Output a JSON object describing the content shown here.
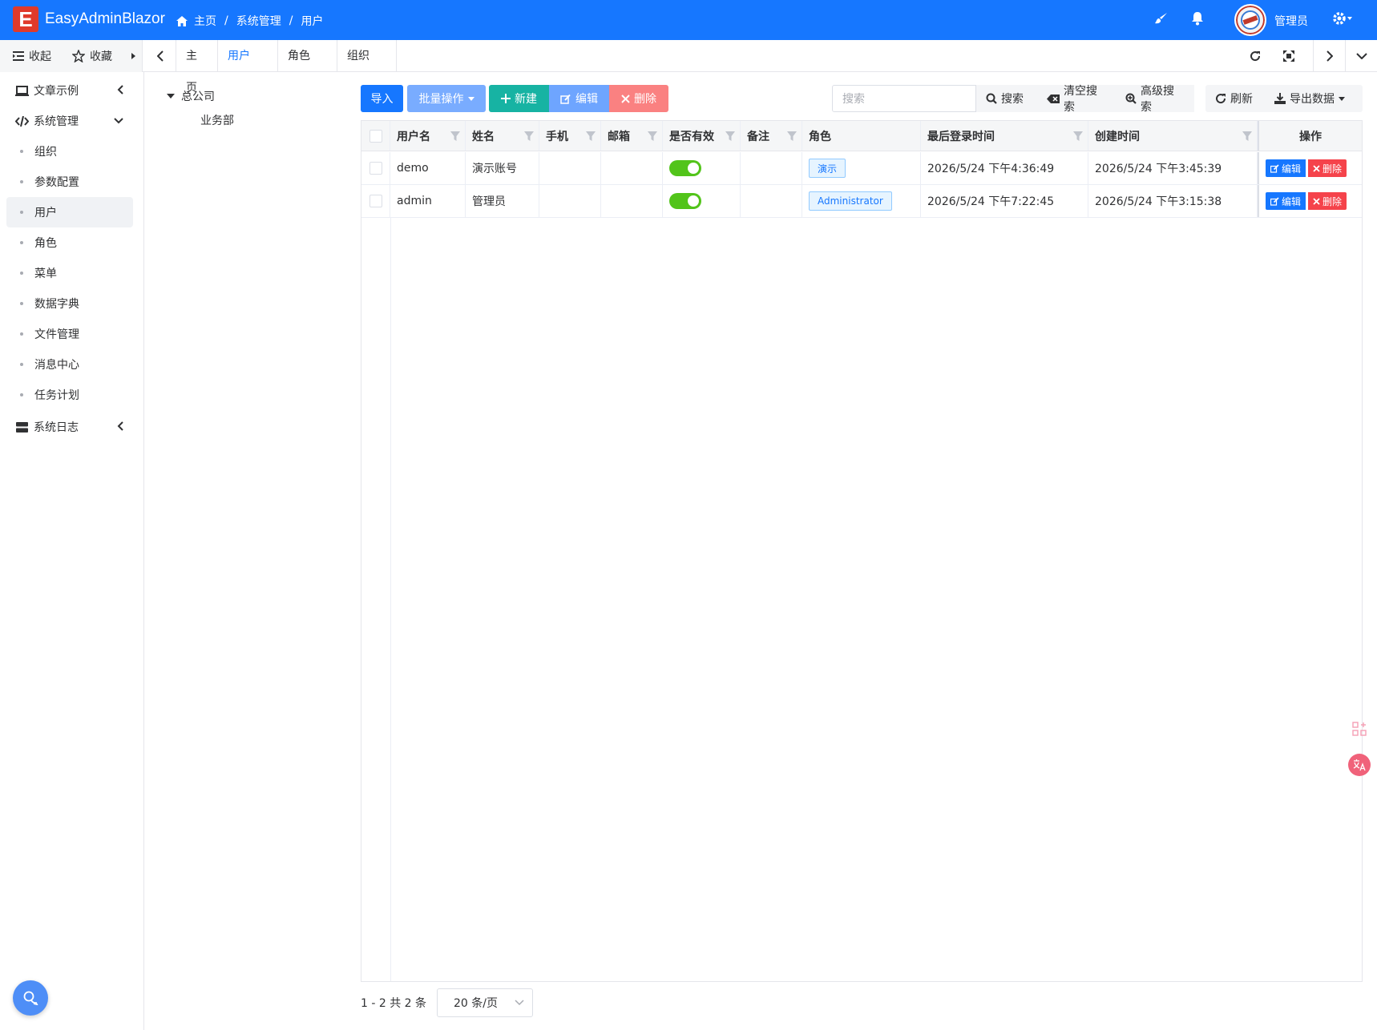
{
  "header": {
    "logo_letter": "E",
    "app_title": "EasyAdminBlazor",
    "breadcrumb": [
      "主页",
      "系统管理",
      "用户"
    ],
    "user_name": "管理员"
  },
  "tabbar": {
    "collapse_label": "收起",
    "favorites_label": "收藏",
    "tabs": [
      "主页",
      "用户",
      "角色",
      "组织"
    ],
    "active_tab": "用户"
  },
  "sidebar": {
    "groups": [
      {
        "label": "文章示例",
        "icon": "laptop-icon",
        "expanded": false
      },
      {
        "label": "系统管理",
        "icon": "code-icon",
        "expanded": true
      },
      {
        "label": "系统日志",
        "icon": "server-icon",
        "expanded": false
      }
    ],
    "sub_items": [
      "组织",
      "参数配置",
      "用户",
      "角色",
      "菜单",
      "数据字典",
      "文件管理",
      "消息中心",
      "任务计划"
    ],
    "active_item": "用户"
  },
  "org_tree": {
    "root": "总公司",
    "children": [
      "业务部"
    ]
  },
  "toolbar": {
    "import": "导入",
    "batch": "批量操作",
    "new": "新建",
    "edit": "编辑",
    "delete": "删除",
    "search_placeholder": "搜索",
    "search": "搜索",
    "clear_search": "清空搜索",
    "advanced_search": "高级搜索",
    "refresh": "刷新",
    "export": "导出数据"
  },
  "table": {
    "columns": [
      "用户名",
      "姓名",
      "手机",
      "邮箱",
      "是否有效",
      "备注",
      "角色",
      "最后登录时间",
      "创建时间",
      "操作"
    ],
    "rows": [
      {
        "username": "demo",
        "name": "演示账号",
        "phone": "",
        "email": "",
        "active": true,
        "remark": "",
        "role": "演示",
        "last_login": "2026/5/24 下午4:36:49",
        "created": "2026/5/24 下午3:45:39"
      },
      {
        "username": "admin",
        "name": "管理员",
        "phone": "",
        "email": "",
        "active": true,
        "remark": "",
        "role": "Administrator",
        "last_login": "2026/5/24 下午7:22:45",
        "created": "2026/5/24 下午3:15:38"
      }
    ],
    "row_edit": "编辑",
    "row_delete": "删除"
  },
  "pagination": {
    "info": "1 - 2 共 2 条",
    "page_size": "20 条/页"
  },
  "colors": {
    "primary": "#1677ff",
    "success": "#52c41a",
    "danger": "#f5434b",
    "teal": "#17b3a3"
  }
}
